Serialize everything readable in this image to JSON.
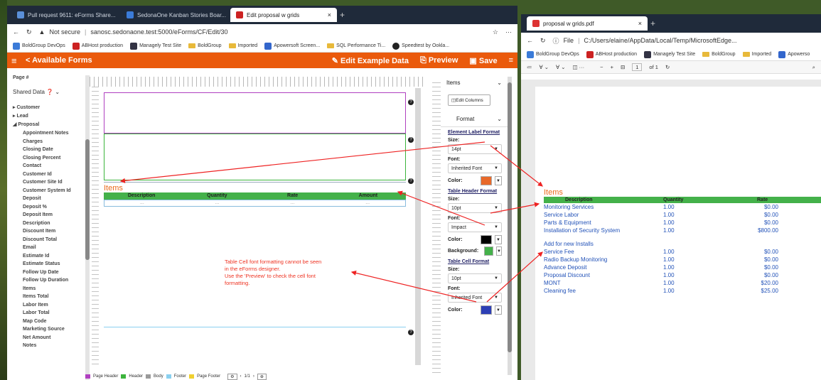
{
  "browser1": {
    "tabs": [
      {
        "label": "Pull request 9611: eForms Share..."
      },
      {
        "label": "SedonaOne Kanban Stories Boar..."
      },
      {
        "label": "Edit proposal w grids"
      }
    ],
    "security": "Not secure",
    "url": "sanosc.sedonaone.test:5000/eForms/CF/Edit/30",
    "bookmarks": [
      "BoldGroup DevOps",
      "ABHost production",
      "Managely Test Site",
      "BoldGroup",
      "Imported",
      "Apowersoft Screen...",
      "SQL Performance Ti...",
      "Speedtest by Ookla..."
    ]
  },
  "toolbar": {
    "available_forms": "< Available Forms",
    "edit_example": "Edit Example Data",
    "preview": "Preview",
    "save": "Save"
  },
  "sidebar": {
    "top": "Page #",
    "shared": "Shared Data",
    "groups": [
      "Customer",
      "Lead",
      "Proposal"
    ],
    "items": [
      "Appointment Notes",
      "Charges",
      "Closing Date",
      "Closing Percent",
      "Contact",
      "Customer Id",
      "Customer Site Id",
      "Customer System Id",
      "Deposit",
      "Deposit %",
      "Deposit Item",
      "Description",
      "Discount Item",
      "Discount Total",
      "Email",
      "Estimate Id",
      "Estimate Status",
      "Follow Up Date",
      "Follow Up Duration",
      "Items",
      "Items Total",
      "Labor Item",
      "Labor Total",
      "Map Code",
      "Marketing Source",
      "Net Amount",
      "Notes"
    ]
  },
  "designer": {
    "items_label": "Items",
    "headers": [
      "Description",
      "Quantity",
      "Rate",
      "Amount"
    ],
    "row": [
      "...",
      "...",
      "...",
      "..."
    ],
    "note": [
      "Table Cell font formatting cannot be seen",
      "in the eForms designer.",
      "Use the 'Preview' to check the cell font",
      "formatting."
    ]
  },
  "props": {
    "items": "Items",
    "edit_columns": "Edit Columns",
    "format": "Format",
    "element_label": "Element Label Format",
    "size_label": "Size:",
    "size1": "14pt",
    "font_label": "Font:",
    "font1": "Inherited Font",
    "color_label": "Color:",
    "color1": "#e8692a",
    "table_header": "Table Header Format",
    "size2": "10pt",
    "font2": "Impact",
    "color2": "#000000",
    "background_label": "Background:",
    "bg2": "#44b14a",
    "table_cell": "Table Cell Format",
    "size3": "10pt",
    "font3": "Inherited Font",
    "color3": "#2d3fb5"
  },
  "footer": {
    "legend": [
      "Page Header",
      "Header",
      "Body",
      "Footer",
      "Page Footer"
    ],
    "legend_colors": [
      "#b040c0",
      "#3cb43c",
      "#9a9a9a",
      "#8ad0f0",
      "#f0d030"
    ],
    "pager": "1/1"
  },
  "browser2": {
    "tab": "proposal w grids.pdf",
    "file": "File",
    "path": "C:/Users/elaine/AppData/Local/Temp/MicrosoftEdge...",
    "bookmarks": [
      "BoldGroup DevOps",
      "ABHost production",
      "Managely Test Site",
      "BoldGroup",
      "Imported",
      "Apowerso"
    ],
    "page": "1",
    "of": "of 1"
  },
  "report": {
    "title": "Items",
    "headers": [
      "Description",
      "Quantity",
      "Rate"
    ],
    "rows": [
      [
        "Monitoring Services",
        "1.00",
        "$0.00"
      ],
      [
        "Service Labor",
        "1.00",
        "$0.00"
      ],
      [
        "Parts & Equipment",
        "1.00",
        "$0.00"
      ],
      [
        "Installation of Security System",
        "1.00",
        "$800.00"
      ],
      [
        "Add for new Installs",
        "",
        ""
      ],
      [
        "Service Fee",
        "1.00",
        "$0.00"
      ],
      [
        "Radio Backup Monitoring",
        "1.00",
        "$0.00"
      ],
      [
        "Advance Deposit",
        "1.00",
        "$0.00"
      ],
      [
        "Proposal Discount",
        "1.00",
        "$0.00"
      ],
      [
        "MONT",
        "1.00",
        "$20.00"
      ],
      [
        "Cleaning fee",
        "1.00",
        "$25.00"
      ]
    ]
  }
}
